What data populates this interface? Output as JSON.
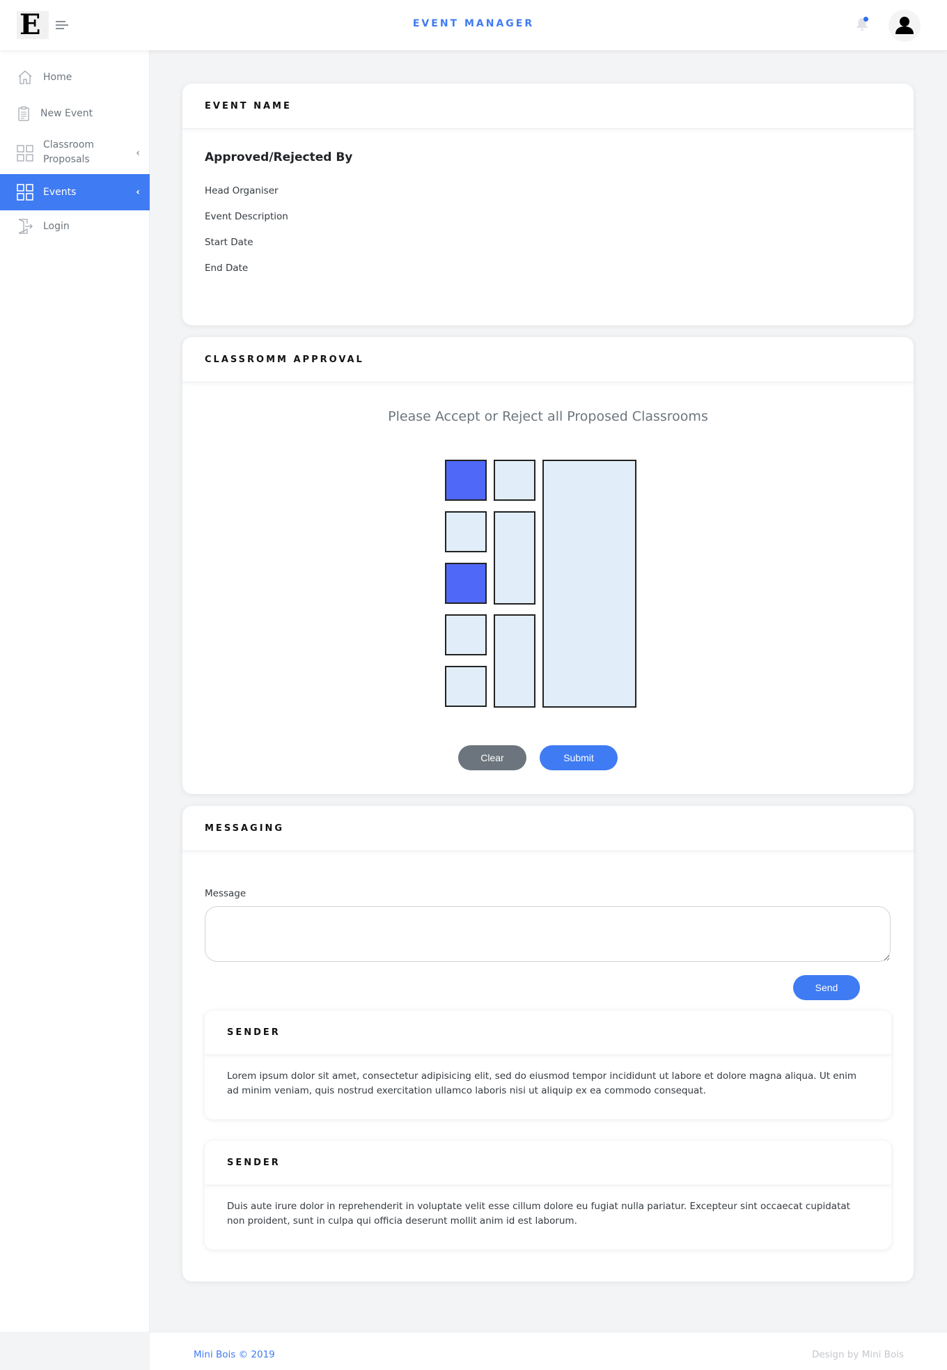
{
  "header": {
    "logo_letter": "E",
    "title": "EVENT MANAGER"
  },
  "sidebar": {
    "items": [
      {
        "label": "Home",
        "icon": "home-icon"
      },
      {
        "label": "New Event",
        "icon": "clipboard-icon"
      },
      {
        "label": "Classroom Proposals",
        "icon": "grid-icon",
        "has_chevron": true
      },
      {
        "label": "Events",
        "icon": "grid-icon",
        "has_chevron": true,
        "active": true
      },
      {
        "label": "Login",
        "icon": "login-icon"
      }
    ],
    "chevron": "‹"
  },
  "event_card": {
    "title": "EVENT NAME",
    "subheading": "Approved/Rejected By",
    "fields": [
      "Head Organiser",
      "Event Description",
      "Start Date",
      "End Date"
    ]
  },
  "classroom_card": {
    "title": "CLASSROMM APPROVAL",
    "prompt": "Please Accept or Reject all Proposed Classrooms",
    "rooms_selected": [
      true,
      false,
      false,
      false,
      false,
      true,
      false,
      false,
      false,
      false
    ],
    "clear_label": "Clear",
    "submit_label": "Submit",
    "accent_color": "#4f68f8",
    "room_color": "#e1eef9"
  },
  "messaging_card": {
    "title": "MESSAGING",
    "message_label": "Message",
    "message_value": "",
    "send_label": "Send",
    "messages": [
      {
        "sender": "SENDER",
        "body": "Lorem ipsum dolor sit amet, consectetur adipisicing elit, sed do eiusmod tempor incididunt ut labore et dolore magna aliqua. Ut enim ad minim veniam, quis nostrud exercitation ullamco laboris nisi ut aliquip ex ea commodo consequat."
      },
      {
        "sender": "SENDER",
        "body": "Duis aute irure dolor in reprehenderit in voluptate velit esse cillum dolore eu fugiat nulla pariatur. Excepteur sint occaecat cupidatat non proident, sunt in culpa qui officia deserunt mollit anim id est laborum."
      }
    ]
  },
  "footer": {
    "left": "Mini Bois © 2019",
    "right": "Design by Mini Bois"
  },
  "colors": {
    "primary": "#3f7bf3",
    "secondary_button": "#6c757d"
  }
}
